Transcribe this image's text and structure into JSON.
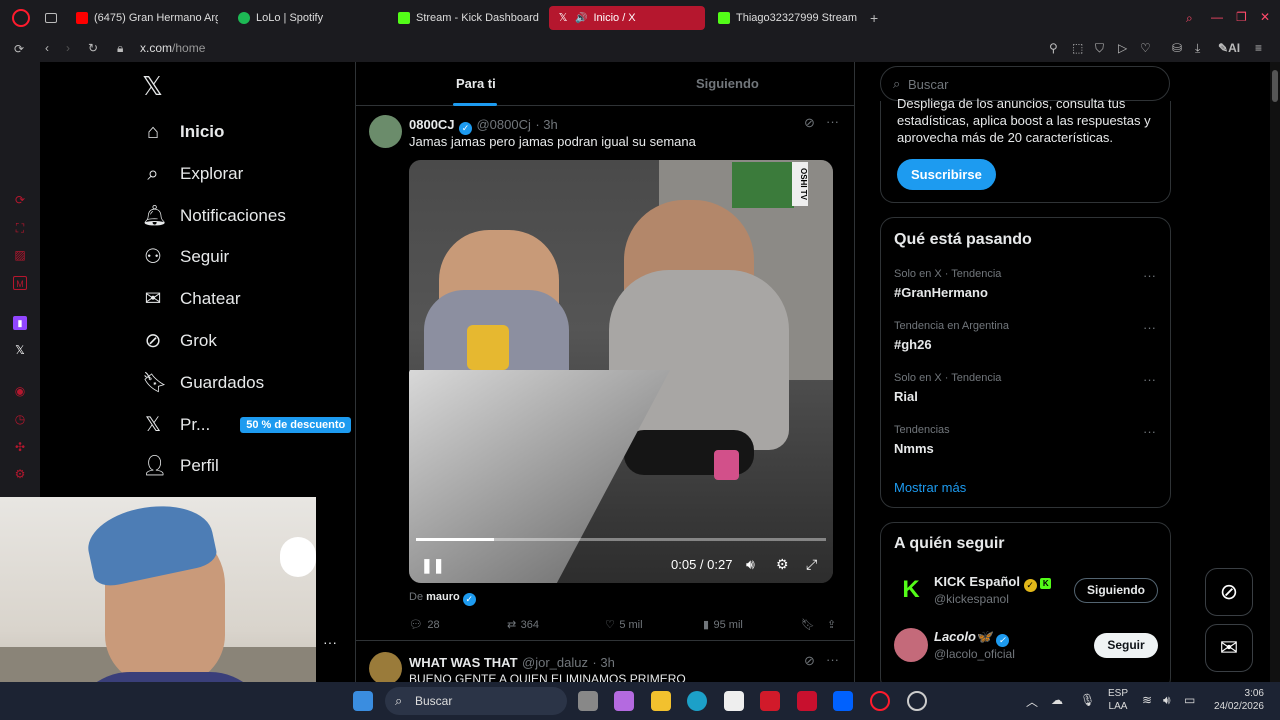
{
  "browser": {
    "tabs": [
      {
        "label": "(6475) Gran Hermano Arge",
        "color": "#ff0000"
      },
      {
        "label": "LoLo | Spotify",
        "color": "#1db954"
      },
      {
        "label": "Stream - Kick Dashboard",
        "color": "#53fc18"
      },
      {
        "label": "Inicio / X",
        "color": "#ffffff"
      },
      {
        "label": "Thiago32327999 Stream -",
        "color": "#53fc18"
      }
    ],
    "url_domain": "x.com",
    "url_path": "/home",
    "ai_label": "AI"
  },
  "nav": {
    "logo": "x-logo-icon",
    "items": [
      {
        "label": "Inicio",
        "icon": "home-icon"
      },
      {
        "label": "Explorar",
        "icon": "search-icon"
      },
      {
        "label": "Notificaciones",
        "icon": "bell-icon"
      },
      {
        "label": "Seguir",
        "icon": "add-person-icon"
      },
      {
        "label": "Chatear",
        "icon": "envelope-icon"
      },
      {
        "label": "Grok",
        "icon": "grok-icon"
      },
      {
        "label": "Guardados",
        "icon": "bookmark-icon"
      },
      {
        "label": "Pr...",
        "icon": "x-icon"
      },
      {
        "label": "Perfil",
        "icon": "person-icon"
      }
    ],
    "promo": "50 % de descuento",
    "more": "···"
  },
  "feed": {
    "tabs": [
      "Para ti",
      "Siguiendo"
    ],
    "post1": {
      "name": "0800CJ",
      "handle": "@0800Cj",
      "time": "· 3h",
      "text": "Jamas jamas pero jamas podran igual su semana",
      "watermark": "OSHI TV",
      "video_time": "0:05 / 0:27",
      "progress": 0.19,
      "from_prefix": "De",
      "from_name": "mauro",
      "replies": "28",
      "reposts": "364",
      "likes": "5 mil",
      "views": "95 mil"
    },
    "post2": {
      "name": "WHAT WAS THAT",
      "handle": "@jor_daluz",
      "time": "· 3h",
      "text": "BUENO GENTE A QUIEN ELIMINAMOS PRIMERO"
    }
  },
  "right": {
    "search_placeholder": "Buscar",
    "premium_text": "Despliega de los anuncios, consulta tus estadísticas, aplica boost a las respuestas y aprovecha más de 20 características.",
    "subscribe": "Suscribirse",
    "trending_title": "Qué está pasando",
    "trends": [
      {
        "sub": "Solo en X · Tendencia",
        "main": "#GranHermano"
      },
      {
        "sub": "Tendencia en Argentina",
        "main": "#gh26"
      },
      {
        "sub": "Solo en X · Tendencia",
        "main": "Rial"
      },
      {
        "sub": "Tendencias",
        "main": "Nmms"
      }
    ],
    "show_more": "Mostrar más",
    "follow_title": "A quién seguir",
    "follows": [
      {
        "name": "KICK Español",
        "handle": "@kickespanol",
        "button": "Siguiendo"
      },
      {
        "name": "Lacolo🦋",
        "handle": "@lacolo_oficial",
        "button": "Seguir"
      }
    ]
  },
  "taskbar": {
    "search": "Buscar",
    "lang1": "ESP",
    "lang2": "LAA",
    "time": "3:06",
    "date": "24/02/2026"
  }
}
